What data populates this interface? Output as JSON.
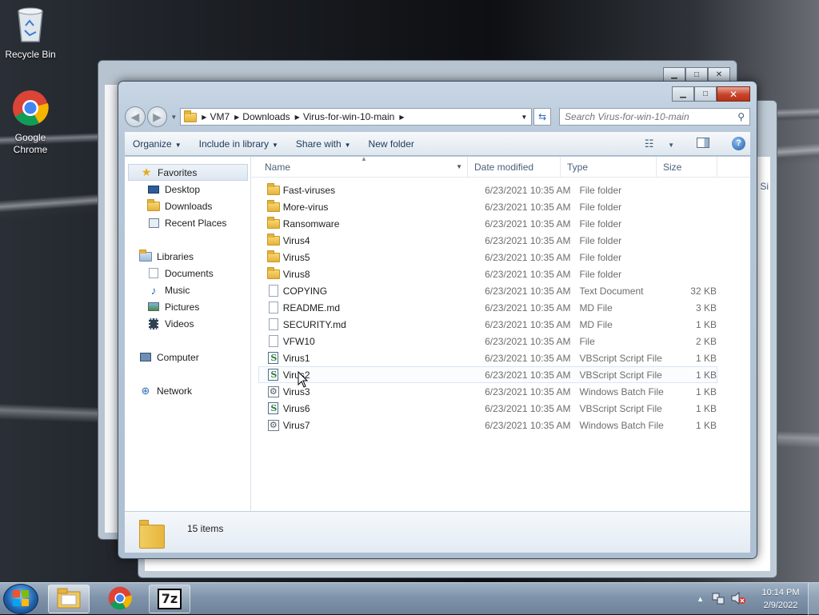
{
  "desktop": {
    "icons": [
      {
        "label": "Recycle Bin",
        "icon": "recycle-bin-icon"
      },
      {
        "label": "Google\nChrome",
        "icon": "chrome-icon"
      }
    ]
  },
  "back_window": {
    "partial_column": "Si"
  },
  "window": {
    "address": {
      "crumbs": [
        "VM7",
        "Downloads",
        "Virus-for-win-10-main"
      ]
    },
    "search": {
      "placeholder": "Search Virus-for-win-10-main"
    },
    "toolbar": {
      "organize": "Organize",
      "include_in_library": "Include in library",
      "share_with": "Share with",
      "new_folder": "New folder"
    },
    "nav": {
      "favorites": "Favorites",
      "favorites_items": [
        "Desktop",
        "Downloads",
        "Recent Places"
      ],
      "libraries": "Libraries",
      "libraries_items": [
        "Documents",
        "Music",
        "Pictures",
        "Videos"
      ],
      "computer": "Computer",
      "network": "Network"
    },
    "columns": {
      "name": "Name",
      "date": "Date modified",
      "type": "Type",
      "size": "Size"
    },
    "files": [
      {
        "name": "Fast-viruses",
        "date": "6/23/2021 10:35 AM",
        "type": "File folder",
        "size": "",
        "icon": "folder-icon"
      },
      {
        "name": "More-virus",
        "date": "6/23/2021 10:35 AM",
        "type": "File folder",
        "size": "",
        "icon": "folder-icon"
      },
      {
        "name": "Ransomware",
        "date": "6/23/2021 10:35 AM",
        "type": "File folder",
        "size": "",
        "icon": "folder-icon"
      },
      {
        "name": "Virus4",
        "date": "6/23/2021 10:35 AM",
        "type": "File folder",
        "size": "",
        "icon": "folder-icon"
      },
      {
        "name": "Virus5",
        "date": "6/23/2021 10:35 AM",
        "type": "File folder",
        "size": "",
        "icon": "folder-icon"
      },
      {
        "name": "Virus8",
        "date": "6/23/2021 10:35 AM",
        "type": "File folder",
        "size": "",
        "icon": "folder-icon"
      },
      {
        "name": "COPYING",
        "date": "6/23/2021 10:35 AM",
        "type": "Text Document",
        "size": "32 KB",
        "icon": "document-icon"
      },
      {
        "name": "README.md",
        "date": "6/23/2021 10:35 AM",
        "type": "MD File",
        "size": "3 KB",
        "icon": "document-icon"
      },
      {
        "name": "SECURITY.md",
        "date": "6/23/2021 10:35 AM",
        "type": "MD File",
        "size": "1 KB",
        "icon": "document-icon"
      },
      {
        "name": "VFW10",
        "date": "6/23/2021 10:35 AM",
        "type": "File",
        "size": "2 KB",
        "icon": "document-icon"
      },
      {
        "name": "Virus1",
        "date": "6/23/2021 10:35 AM",
        "type": "VBScript Script File",
        "size": "1 KB",
        "icon": "vbscript-icon"
      },
      {
        "name": "Virus2",
        "date": "6/23/2021 10:35 AM",
        "type": "VBScript Script File",
        "size": "1 KB",
        "icon": "vbscript-icon"
      },
      {
        "name": "Virus3",
        "date": "6/23/2021 10:35 AM",
        "type": "Windows Batch File",
        "size": "1 KB",
        "icon": "batch-file-icon"
      },
      {
        "name": "Virus6",
        "date": "6/23/2021 10:35 AM",
        "type": "VBScript Script File",
        "size": "1 KB",
        "icon": "vbscript-icon"
      },
      {
        "name": "Virus7",
        "date": "6/23/2021 10:35 AM",
        "type": "Windows Batch File",
        "size": "1 KB",
        "icon": "batch-file-icon"
      }
    ],
    "status": {
      "item_count": "15 items"
    }
  },
  "taskbar": {
    "apps": [
      "windows-explorer-icon",
      "chrome-icon",
      "7zip-icon"
    ],
    "sevenzip_label": "7z",
    "clock": {
      "time": "10:14 PM",
      "date": "2/9/2022"
    }
  }
}
